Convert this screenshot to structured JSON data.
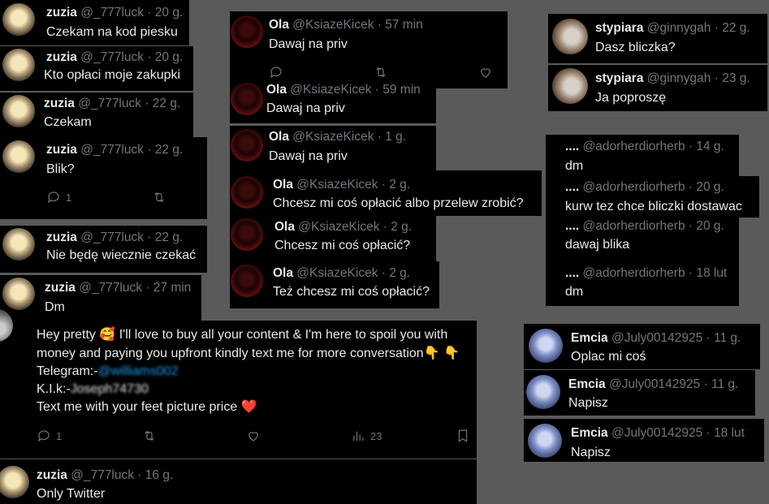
{
  "zuzia_posts": [
    {
      "name": "zuzia",
      "handle": "@_777luck",
      "time": "20 g.",
      "text": "Czekam na kod piesku"
    },
    {
      "name": "zuzia",
      "handle": "@_777luck",
      "time": "20 g.",
      "text": "Kto opłaci moje zakupki"
    },
    {
      "name": "zuzia",
      "handle": "@_777luck",
      "time": "22 g.",
      "text": "Czekam"
    },
    {
      "name": "zuzia",
      "handle": "@_777luck",
      "time": "22 g.",
      "text": "Blik?",
      "reply_count": "1"
    },
    {
      "name": "zuzia",
      "handle": "@_777luck",
      "time": "22 g.",
      "text": "Nie będę wiecznie czekać"
    },
    {
      "name": "zuzia",
      "handle": "@_777luck",
      "time": "27 min",
      "text": "Dm"
    }
  ],
  "ola_posts": [
    {
      "name": "Ola",
      "handle": "@KsiazeKicek",
      "time": "57 min",
      "text": "Dawaj na priv"
    },
    {
      "name": "Ola",
      "handle": "@KsiazeKicek",
      "time": "59 min",
      "text": "Dawaj na priv"
    },
    {
      "name": "Ola",
      "handle": "@KsiazeKicek",
      "time": "1 g.",
      "text": "Dawaj na priv"
    },
    {
      "name": "Ola",
      "handle": "@KsiazeKicek",
      "time": "2 g.",
      "text": "Chcesz mi coś opłacić albo przelew zrobić?"
    },
    {
      "name": "Ola",
      "handle": "@KsiazeKicek",
      "time": "2 g.",
      "text": "Chcesz mi coś opłacić?"
    },
    {
      "name": "Ola",
      "handle": "@KsiazeKicek",
      "time": "2 g.",
      "text": "Też chcesz mi coś opłacić?"
    }
  ],
  "stypiara_posts": [
    {
      "name": "stypiara",
      "handle": "@ginnygah",
      "time": "22 g.",
      "text": "Dasz bliczka?"
    },
    {
      "name": "stypiara",
      "handle": "@ginnygah",
      "time": "23 g.",
      "text": "Ja poproszę"
    }
  ],
  "ador_posts": [
    {
      "name": "....",
      "handle": "@adorherdiorherb",
      "time": "14 g.",
      "text": "dm"
    },
    {
      "name": "....",
      "handle": "@adorherdiorherb",
      "time": "20 g.",
      "text": "kurw tez chce bliczki dostawac"
    },
    {
      "name": "....",
      "handle": "@adorherdiorherb",
      "time": "20 g.",
      "text": "dawaj blika"
    },
    {
      "name": "....",
      "handle": "@adorherdiorherb",
      "time": "18 lut",
      "text": "dm"
    }
  ],
  "emcia_posts": [
    {
      "name": "Emcia",
      "handle": "@July00142925",
      "time": "11 g.",
      "text": "Oplac mi coś"
    },
    {
      "name": "Emcia",
      "handle": "@July00142925",
      "time": "11 g.",
      "text": "Napisz"
    },
    {
      "name": "Emcia",
      "handle": "@July00142925",
      "time": "18 lut",
      "text": "Napisz"
    }
  ],
  "spam_post": {
    "line1": "Hey pretty 🥰 I'll love to buy all your content & I'm here to spoil you with",
    "line2": "money and paying you upfront kindly text me for more conversation👇 👇",
    "telegram_label": "Telegram:-",
    "telegram_handle": "@williams002",
    "klik_label": "K.I.k:-",
    "klik_value": "Joseph74730",
    "line5": "Text me with your feet picture price ❤️",
    "reply_count": "1",
    "views_count": "23"
  },
  "bottom_post": {
    "name": "zuzia",
    "handle": "@_777luck",
    "time": "16 g.",
    "text": "Only Twitter"
  },
  "sep": " · "
}
